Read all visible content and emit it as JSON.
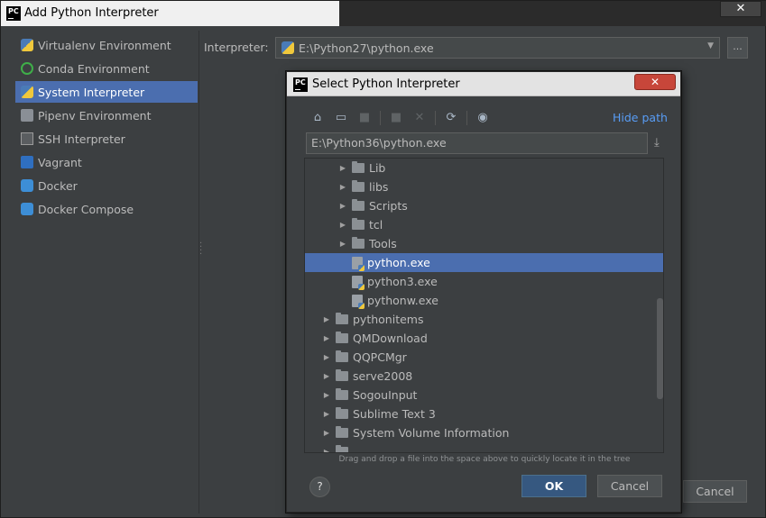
{
  "window": {
    "title": "Add Python Interpreter",
    "close_glyph": "✕",
    "app_logo_text": "PC"
  },
  "sidebar": {
    "items": [
      {
        "label": "Virtualenv Environment",
        "icon": "python-icon",
        "selected": false
      },
      {
        "label": "Conda Environment",
        "icon": "conda-ring-icon",
        "selected": false
      },
      {
        "label": "System Interpreter",
        "icon": "python-icon",
        "selected": true
      },
      {
        "label": "Pipenv Environment",
        "icon": "pipenv-icon",
        "selected": false
      },
      {
        "label": "SSH Interpreter",
        "icon": "terminal-icon",
        "selected": false
      },
      {
        "label": "Vagrant",
        "icon": "vagrant-icon",
        "selected": false
      },
      {
        "label": "Docker",
        "icon": "docker-icon",
        "selected": false
      },
      {
        "label": "Docker Compose",
        "icon": "docker-icon",
        "selected": false
      }
    ]
  },
  "main": {
    "interpreter_label": "Interpreter:",
    "interpreter_value": "E:\\Python27\\python.exe",
    "browse_label": "...",
    "cancel_label": "Cancel"
  },
  "dialog": {
    "title": "Select Python Interpreter",
    "close_glyph": "✕",
    "hide_path_label": "Hide path",
    "path_value": "E:\\Python36\\python.exe",
    "toolbar_icons": [
      "home-icon",
      "desktop-icon",
      "project-folder-icon",
      "new-folder-icon",
      "delete-icon",
      "refresh-icon",
      "show-hidden-icon"
    ],
    "tree": [
      {
        "label": "Lib",
        "type": "folder",
        "level": 2,
        "expandable": true,
        "selected": false
      },
      {
        "label": "libs",
        "type": "folder",
        "level": 2,
        "expandable": true,
        "selected": false
      },
      {
        "label": "Scripts",
        "type": "folder",
        "level": 2,
        "expandable": true,
        "selected": false
      },
      {
        "label": "tcl",
        "type": "folder",
        "level": 2,
        "expandable": true,
        "selected": false
      },
      {
        "label": "Tools",
        "type": "folder",
        "level": 2,
        "expandable": true,
        "selected": false
      },
      {
        "label": "python.exe",
        "type": "file",
        "level": 2,
        "expandable": false,
        "selected": true
      },
      {
        "label": "python3.exe",
        "type": "file",
        "level": 2,
        "expandable": false,
        "selected": false
      },
      {
        "label": "pythonw.exe",
        "type": "file",
        "level": 2,
        "expandable": false,
        "selected": false
      },
      {
        "label": "pythonitems",
        "type": "folder",
        "level": 1,
        "expandable": true,
        "selected": false
      },
      {
        "label": "QMDownload",
        "type": "folder",
        "level": 1,
        "expandable": true,
        "selected": false
      },
      {
        "label": "QQPCMgr",
        "type": "folder",
        "level": 1,
        "expandable": true,
        "selected": false
      },
      {
        "label": "serve2008",
        "type": "folder",
        "level": 1,
        "expandable": true,
        "selected": false
      },
      {
        "label": "SogouInput",
        "type": "folder",
        "level": 1,
        "expandable": true,
        "selected": false
      },
      {
        "label": "Sublime Text 3",
        "type": "folder",
        "level": 1,
        "expandable": true,
        "selected": false
      },
      {
        "label": "System Volume Information",
        "type": "folder",
        "level": 1,
        "expandable": true,
        "selected": false
      }
    ],
    "hint": "Drag and drop a file into the space above to quickly locate it in the tree",
    "help_label": "?",
    "ok_label": "OK",
    "cancel_label": "Cancel"
  }
}
